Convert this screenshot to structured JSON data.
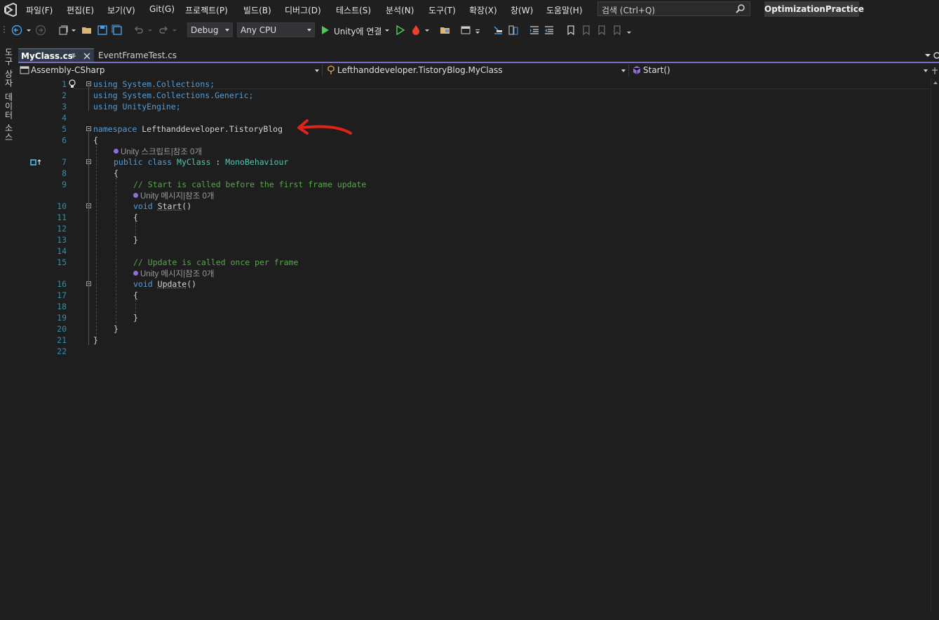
{
  "menu": {
    "items": [
      "파일(F)",
      "편집(E)",
      "보기(V)",
      "Git(G)",
      "프로젝트(P)",
      "빌드(B)",
      "디버그(D)",
      "테스트(S)",
      "분석(N)",
      "도구(T)",
      "확장(X)",
      "창(W)",
      "도움말(H)"
    ],
    "search_placeholder": "검색 (Ctrl+Q)",
    "solution_name": "OptimizationPractice"
  },
  "toolbar": {
    "config": "Debug",
    "platform": "Any CPU",
    "run_label": "Unity에 연결"
  },
  "side_panel": {
    "items": [
      "도구 상자",
      "데이터 소스"
    ]
  },
  "tabs": [
    {
      "label": "MyClass.cs",
      "active": true
    },
    {
      "label": "EventFrameTest.cs",
      "active": false
    }
  ],
  "navbar": {
    "project": "Assembly-CSharp",
    "type": "Lefthanddeveloper.TistoryBlog.MyClass",
    "member": "Start()"
  },
  "code": {
    "line_numbers": [
      "1",
      "2",
      "3",
      "4",
      "5",
      "6",
      "7",
      "8",
      "9",
      "10",
      "11",
      "12",
      "13",
      "14",
      "15",
      "16",
      "17",
      "18",
      "19",
      "20",
      "21",
      "22"
    ],
    "using1": "using System.Collections;",
    "using2": "using System.Collections.Generic;",
    "using3": "using UnityEngine;",
    "namespace_kw": "namespace",
    "namespace_name": " Lefthanddeveloper.TistoryBlog",
    "lens_class": "Unity 스크립트|참조 0개",
    "class_kw": "public class",
    "class_name": "MyClass",
    "class_colon": " : ",
    "base_class": "MonoBehaviour",
    "comment_start": "// Start is called before the first frame update",
    "lens_start": "Unity 메시지|참조 0개",
    "void_kw": "void",
    "start_method": "Start",
    "comment_update": "// Update is called once per frame",
    "lens_update": "Unity 메시지|참조 0개",
    "update_method": "Update",
    "brace_open": "{",
    "brace_close": "}",
    "parens": "()"
  },
  "colors": {
    "accent": "#7a6ec4",
    "annotation_arrow": "#e0231a"
  }
}
